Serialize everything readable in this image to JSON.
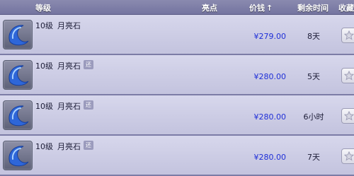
{
  "header": {
    "level": "等级",
    "highlights": "亮点",
    "price": "价钱",
    "price_sort_arrow": "↑",
    "time_left": "剩余时间",
    "favorite": "收藏"
  },
  "colors": {
    "price_text": "#1f2fd8",
    "row_background": "#cdcde6",
    "header_background": "#7d7da6"
  },
  "items": [
    {
      "icon": "moonstone-icon",
      "level": "10级",
      "name": "月亮石",
      "badge": "",
      "price": "¥279.00",
      "time_left": "8天",
      "favorite_icon": "star-icon"
    },
    {
      "icon": "moonstone-icon",
      "level": "10级",
      "name": "月亮石",
      "badge": "还",
      "price": "¥280.00",
      "time_left": "5天",
      "favorite_icon": "star-icon"
    },
    {
      "icon": "moonstone-icon",
      "level": "10级",
      "name": "月亮石",
      "badge": "还",
      "price": "¥280.00",
      "time_left": "6小时",
      "favorite_icon": "star-icon"
    },
    {
      "icon": "moonstone-icon",
      "level": "10级",
      "name": "月亮石",
      "badge": "还",
      "price": "¥280.00",
      "time_left": "7天",
      "favorite_icon": "star-icon"
    }
  ]
}
